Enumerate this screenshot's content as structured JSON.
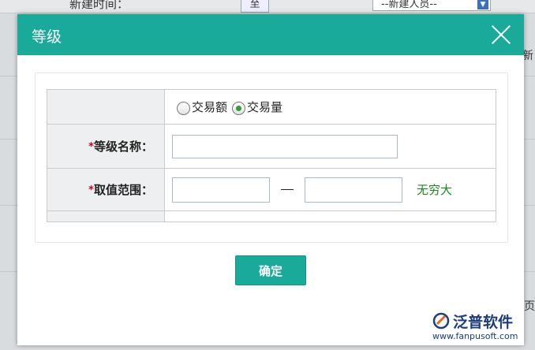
{
  "background": {
    "field_label": "新建时间：",
    "field_value": "至",
    "select_value": "--新建人员--",
    "right_text_1": "新",
    "right_text_2": "页"
  },
  "dialog": {
    "title": "等级",
    "close_icon": "close-icon",
    "header_color": "#1aaa9a",
    "radio": {
      "option1": "交易额",
      "option2": "交易量",
      "selected": "交易量"
    },
    "level_name": {
      "required_mark": "*",
      "label": "等级名称：",
      "value": ""
    },
    "value_range": {
      "required_mark": "*",
      "label": "取值范围：",
      "min_value": "",
      "max_value": "",
      "separator": "—",
      "infinity_text": "无穷大"
    },
    "confirm_button": "确定"
  },
  "watermark": {
    "brand": "泛普软件",
    "url": "www.fanpusoft.com"
  }
}
